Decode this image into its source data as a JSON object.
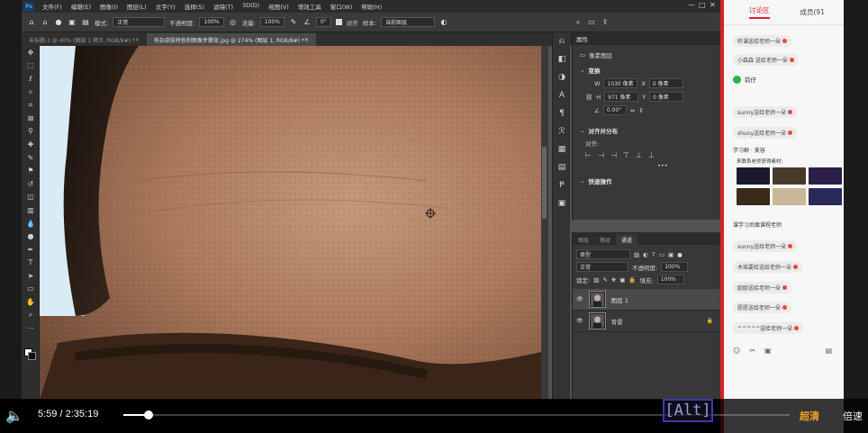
{
  "photoshop": {
    "logo": "Ps",
    "menu": [
      "文件(F)",
      "编辑(E)",
      "图像(I)",
      "图层(L)",
      "文字(Y)",
      "选择(S)",
      "滤镜(T)",
      "3D(D)",
      "视图(V)",
      "增效工具",
      "窗口(W)",
      "帮助(H)"
    ],
    "options_bar": {
      "mode_label": "模式:",
      "mode_value": "正常",
      "opacity_label": "不透明度:",
      "opacity_value": "100%",
      "flow_label": "流量:",
      "flow_value": "100%",
      "angle_value": "0°",
      "align_label": "对齐",
      "sample_label": "样本:",
      "sample_value": "当前图层"
    },
    "tabs": [
      {
        "label": "未标题-1 @ 40% (图层 1 拷贝, RGB/8#) *",
        "active": false
      },
      {
        "label": "有杂皮肤特色制图像步骤效.jpg @ 274% (图层 1, RGB/8#) *",
        "active": true
      }
    ],
    "tools": [
      "move-icon",
      "marquee-icon",
      "lasso-icon",
      "magic-wand-icon",
      "crop-icon",
      "frame-icon",
      "eyedropper-icon",
      "healing-icon",
      "brush-icon",
      "stamp-icon",
      "history-brush-icon",
      "eraser-icon",
      "gradient-icon",
      "blur-icon",
      "dodge-icon",
      "pen-icon",
      "type-icon",
      "path-select-icon",
      "shape-icon",
      "hand-icon",
      "zoom-icon",
      "more-icon"
    ],
    "properties": {
      "title": "属性",
      "pixel_layer": "像素图层",
      "transform_title": "变换",
      "w_label": "W",
      "w_value": "1030 像素",
      "x_label": "X",
      "x_value": "0 像素",
      "h_label": "H",
      "h_value": "971 像素",
      "y_label": "Y",
      "y_value": "0 像素",
      "angle_value": "0.00°",
      "align_title": "对齐并分布",
      "align_label": "对齐:",
      "quick_title": "快速操作"
    },
    "layers": {
      "tabs": [
        {
          "label": "图层",
          "active": false
        },
        {
          "label": "路径",
          "active": false
        },
        {
          "label": "通道",
          "active": true
        }
      ],
      "filter_value": "类型",
      "blend_value": "正常",
      "opacity_label": "不透明度:",
      "opacity_value": "100%",
      "lock_label": "锁定:",
      "fill_label": "填充:",
      "fill_value": "100%",
      "items": [
        {
          "name": "图层 1",
          "selected": true
        },
        {
          "name": "背景",
          "selected": false
        }
      ]
    }
  },
  "chat": {
    "tabs": [
      {
        "label": "讨论区",
        "active": true
      },
      {
        "label": "成员(91",
        "active": false
      }
    ],
    "messages": [
      "听课送给老师一朵",
      "小森森 送给老师一朵",
      "sunny送给老师一朵",
      "shuny送给老师一朵",
      "sunny送给老师一朵",
      "木瑶要给送给老师一朵",
      "欧欧送给老师一朵",
      "愿愿送给老师一朵",
      "^^^^^送给老师一朵"
    ],
    "wechat_label": "前仔",
    "promo_title": "学习群 · 美容",
    "promo_text": "来联系老师获得素材:",
    "study_tag": "课学习后面课程老师"
  },
  "player": {
    "current_time": "5:59",
    "separator": "/",
    "total_time": "2:35:19",
    "progress": 0.0385,
    "quality": "超清",
    "speed": "倍速",
    "alt_key": "[Alt]"
  }
}
